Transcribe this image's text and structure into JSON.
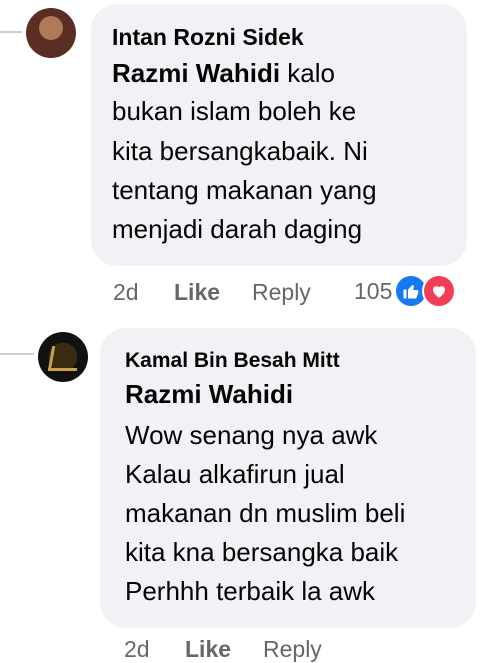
{
  "comments": [
    {
      "author": "Intan Rozni Sidek",
      "mention": "Razmi Wahidi",
      "lines": [
        "kalo",
        "bukan islam boleh ke",
        "kita bersangkabaik. Ni",
        "tentang makanan yang",
        "menjadi darah daging"
      ],
      "time": "2d",
      "like_label": "Like",
      "reply_label": "Reply",
      "reaction_count": "105",
      "reaction_icons": [
        "like-icon",
        "love-icon"
      ],
      "colors": {
        "like": "#1877f2",
        "love": "#f33e58"
      }
    },
    {
      "author": "Kamal Bin Besah Mitt",
      "mention": "Razmi Wahidi",
      "lines": [
        "Wow senang nya awk",
        "Kalau alkafirun jual",
        "makanan dn muslim beli",
        "kita kna bersangka baik",
        "Perhhh terbaik la awk"
      ],
      "time": "2d",
      "like_label": "Like",
      "reply_label": "Reply"
    }
  ]
}
